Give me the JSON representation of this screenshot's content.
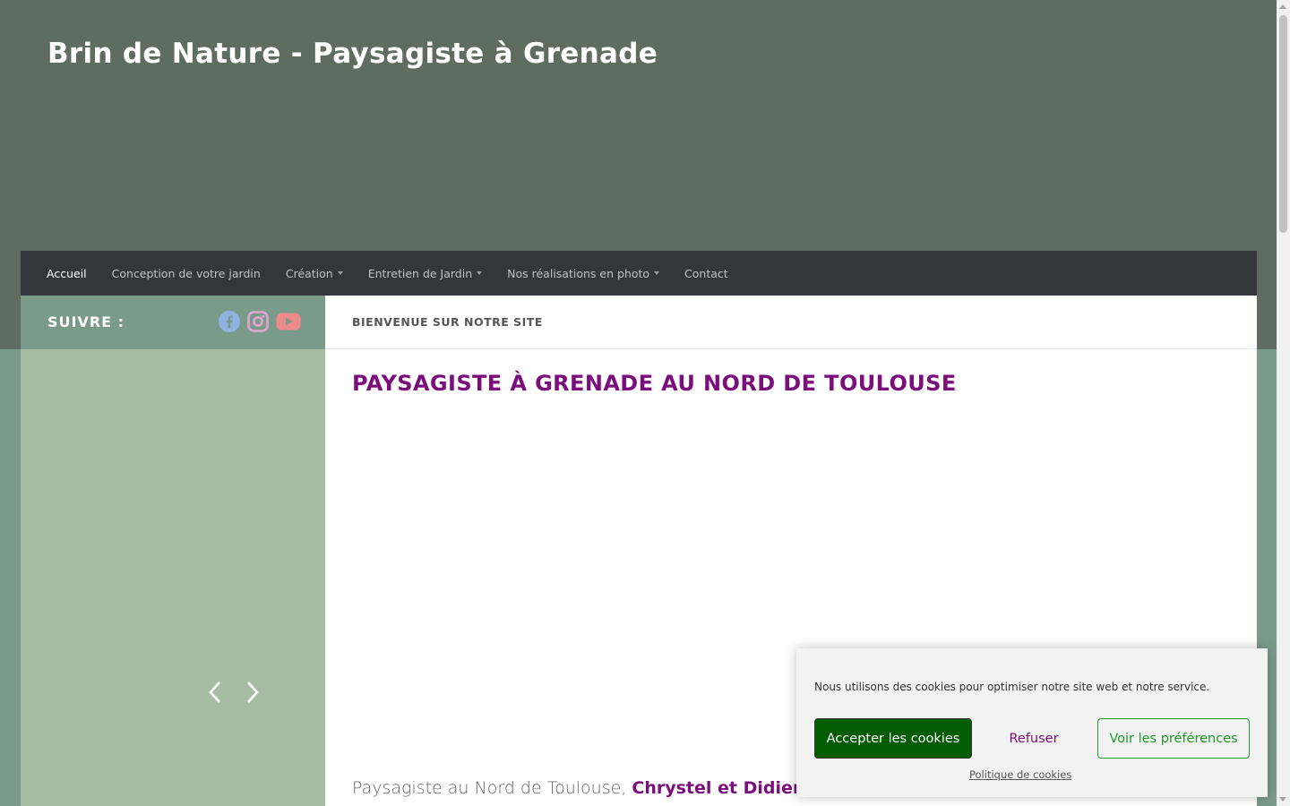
{
  "header": {
    "site_title": "Brin de Nature - Paysagiste à Grenade"
  },
  "nav": {
    "items": [
      {
        "label": "Accueil",
        "active": true,
        "has_caret": false
      },
      {
        "label": "Conception de votre jardin",
        "active": false,
        "has_caret": false
      },
      {
        "label": "Création",
        "active": false,
        "has_caret": true
      },
      {
        "label": "Entretien de Jardin",
        "active": false,
        "has_caret": true
      },
      {
        "label": "Nos réalisations en photo",
        "active": false,
        "has_caret": true
      },
      {
        "label": "Contact",
        "active": false,
        "has_caret": false
      }
    ]
  },
  "sidebar": {
    "follow_label": "SUIVRE :",
    "social_icons": [
      "facebook-icon",
      "instagram-icon",
      "youtube-icon"
    ],
    "slider_arrows": [
      "chevron-left-icon",
      "chevron-right-icon"
    ]
  },
  "main": {
    "breadcrumb_title": "BIENVENUE SUR NOTRE SITE",
    "heading": "PAYSAGISTE À GRENADE AU NORD DE TOULOUSE",
    "intro_prefix": "Paysagiste au Nord de Toulouse, ",
    "intro_names": "Chrystel et Didier"
  },
  "cookie_banner": {
    "message": "Nous utilisons des cookies pour optimiser notre site web et notre service.",
    "accept_label": "Accepter les cookies",
    "refuse_label": "Refuser",
    "preferences_label": "Voir les préférences",
    "policy_link": "Politique de cookies"
  },
  "colors": {
    "header_bg": "#5e6d5f",
    "nav_bg": "#33363b",
    "accent": "#7c0d7c",
    "accept_bg": "#005c00",
    "prefs_border": "#1f9a2b"
  }
}
